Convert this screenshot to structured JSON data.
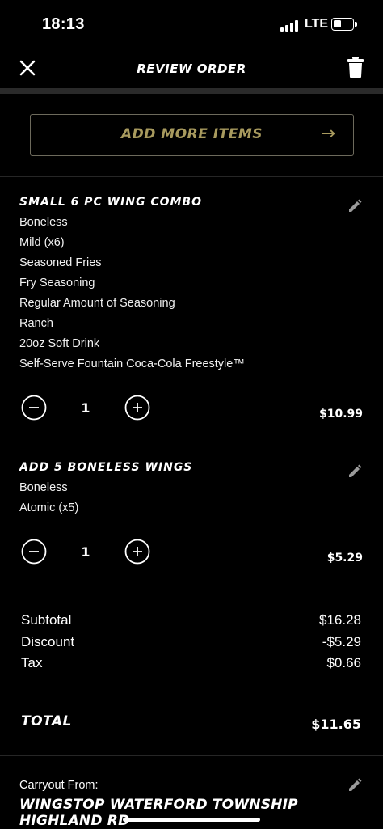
{
  "status_bar": {
    "time": "18:13",
    "network": "LTE"
  },
  "header": {
    "title": "REVIEW ORDER",
    "close_icon": "close-icon",
    "trash_icon": "trash-icon"
  },
  "add_more": {
    "label": "ADD MORE ITEMS",
    "arrow": "→"
  },
  "items": [
    {
      "title": "SMALL 6 PC WING COMBO",
      "details": [
        "Boneless",
        "Mild (x6)",
        "Seasoned Fries",
        "Fry Seasoning",
        "Regular Amount of Seasoning",
        "Ranch",
        "20oz Soft Drink",
        "Self-Serve Fountain Coca-Cola Freestyle™"
      ],
      "quantity": "1",
      "price": "$10.99"
    },
    {
      "title": "ADD 5 BONELESS WINGS",
      "details": [
        "Boneless",
        "Atomic (x5)"
      ],
      "quantity": "1",
      "price": "$5.29"
    }
  ],
  "summary": {
    "subtotal_label": "Subtotal",
    "subtotal": "$16.28",
    "discount_label": "Discount",
    "discount": "-$5.29",
    "tax_label": "Tax",
    "tax": "$0.66"
  },
  "total": {
    "label": "TOTAL",
    "value": "$11.65"
  },
  "carryout": {
    "label": "Carryout From:",
    "store": "WINGSTOP WATERFORD TOWNSHIP HIGHLAND RD"
  },
  "colors": {
    "background": "#000000",
    "accent_gold": "#a89a5e",
    "divider": "#262626"
  }
}
